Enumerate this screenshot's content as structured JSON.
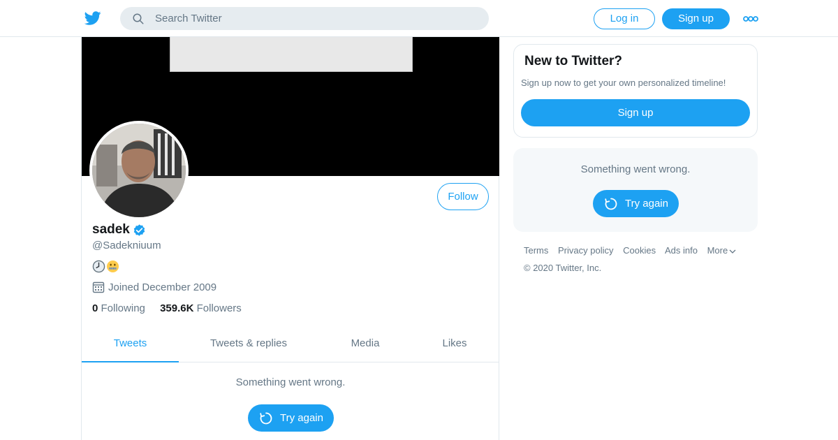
{
  "header": {
    "logo_icon": "twitter-bird-icon",
    "search": {
      "placeholder": "Search Twitter",
      "value": ""
    },
    "login_label": "Log in",
    "signup_label": "Sign up",
    "more_icon": "more-dots-icon"
  },
  "profile": {
    "name": "sadek",
    "verified": true,
    "handle": "@Sadekniuum",
    "bio_icons": [
      "clock-emoji",
      "zipper-mouth-emoji"
    ],
    "joined": "Joined December 2009",
    "following_count": "0",
    "following_label": "Following",
    "followers_count": "359.6K",
    "followers_label": "Followers",
    "follow_label": "Follow"
  },
  "tabs": [
    {
      "label": "Tweets",
      "active": true
    },
    {
      "label": "Tweets & replies",
      "active": false
    },
    {
      "label": "Media",
      "active": false
    },
    {
      "label": "Likes",
      "active": false
    }
  ],
  "timeline": {
    "error_text": "Something went wrong.",
    "retry_label": "Try again"
  },
  "sidebar": {
    "new_card": {
      "title": "New to Twitter?",
      "subtitle": "Sign up now to get your own personalized timeline!",
      "signup_label": "Sign up"
    },
    "error_card": {
      "error_text": "Something went wrong.",
      "retry_label": "Try again"
    },
    "footer": {
      "links": [
        "Terms",
        "Privacy policy",
        "Cookies",
        "Ads info",
        "More"
      ],
      "copyright": "© 2020 Twitter, Inc."
    }
  },
  "colors": {
    "accent": "#1da1f2",
    "secondary_text": "#657786",
    "border": "#e1e8ed"
  }
}
